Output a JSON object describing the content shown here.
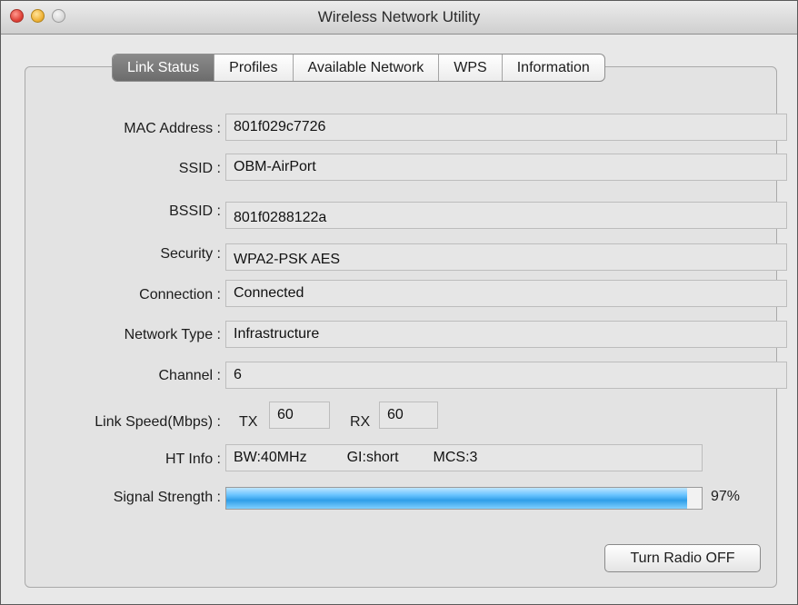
{
  "window": {
    "title": "Wireless Network Utility"
  },
  "tabs": [
    {
      "label": "Link Status",
      "active": true
    },
    {
      "label": "Profiles",
      "active": false
    },
    {
      "label": "Available Network",
      "active": false
    },
    {
      "label": "WPS",
      "active": false
    },
    {
      "label": "Information",
      "active": false
    }
  ],
  "fields": {
    "mac_address": {
      "label": "MAC Address :",
      "value": "801f029c7726"
    },
    "ssid": {
      "label": "SSID :",
      "value": "OBM-AirPort"
    },
    "bssid": {
      "label": "BSSID :",
      "value": "801f0288122a"
    },
    "security": {
      "label": "Security :",
      "value": "WPA2-PSK AES"
    },
    "connection": {
      "label": "Connection :",
      "value": "Connected"
    },
    "network_type": {
      "label": "Network Type :",
      "value": "Infrastructure"
    },
    "channel": {
      "label": "Channel :",
      "value": "6"
    }
  },
  "link_speed": {
    "label": "Link Speed(Mbps) :",
    "tx_label": "TX",
    "tx_value": "60",
    "rx_label": "RX",
    "rx_value": "60"
  },
  "ht_info": {
    "label": "HT Info :",
    "bw": "BW:40MHz",
    "gi": "GI:short",
    "mcs": "MCS:3"
  },
  "signal": {
    "label": "Signal Strength :",
    "percent": 97,
    "percent_text": "97%"
  },
  "buttons": {
    "radio": "Turn Radio OFF"
  },
  "colors": {
    "signal_fill": "#2f9ee8",
    "active_tab": "#7a7a7a"
  }
}
